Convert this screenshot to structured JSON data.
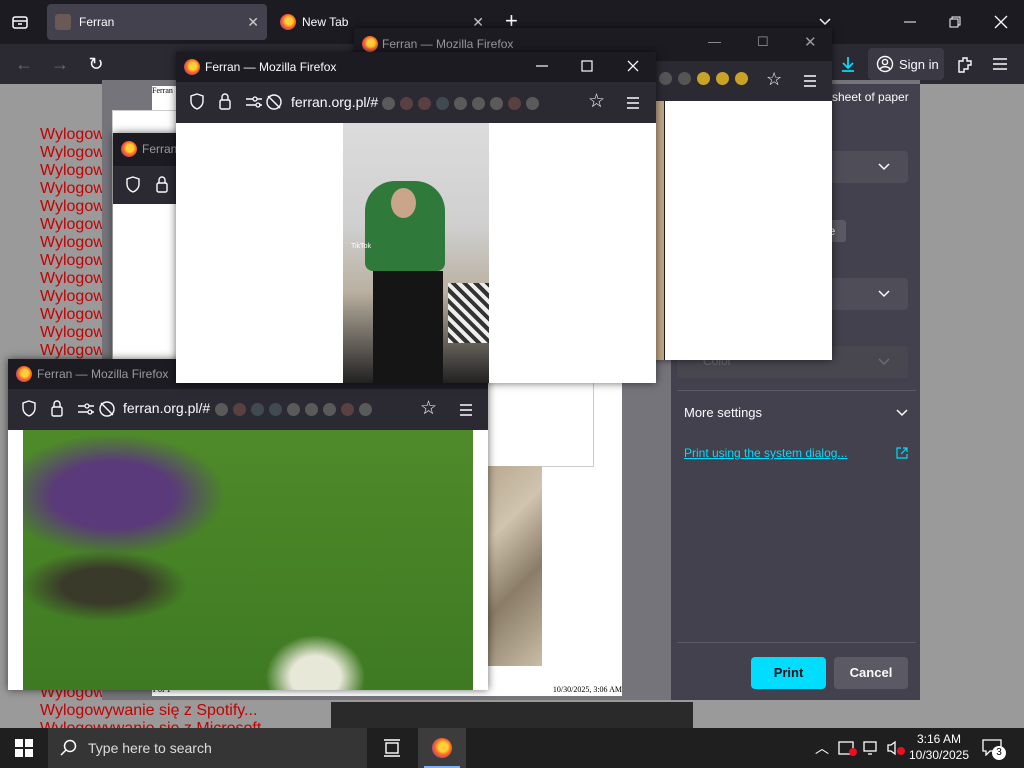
{
  "browser": {
    "tabs": [
      {
        "label": "Ferran",
        "close": "✕"
      },
      {
        "label": "New Tab",
        "close": "✕"
      }
    ],
    "new_tab": "+",
    "sign_in": "Sign in"
  },
  "page": {
    "lines": [
      "Wylogow",
      "Wylogow",
      "Wylogow",
      "Wylogow",
      "Wylogow",
      "Wylogow",
      "Wylogow",
      "Wylogow",
      "Wylogow",
      "Wylogow",
      "Wylogow",
      "Wylogow",
      "Wylogow"
    ],
    "bottom_lines": [
      "Wylogow",
      "Wylogowywanie się z Spotify...",
      "Wylogowywanie się z Microsoft..."
    ]
  },
  "print": {
    "sheet_label": "sheet of paper",
    "color_label": "Color",
    "more_settings": "More settings",
    "system_dialog": "Print using the system dialog...",
    "print_btn": "Print",
    "cancel_btn": "Cancel",
    "preview_header": "Ferran",
    "preview_footer_left": "1 of 1",
    "preview_footer_right": "10/30/2025, 3:06 AM",
    "badge": "e"
  },
  "windows": {
    "back": {
      "title": "Ferran — Mozilla Firefox"
    },
    "front": {
      "title": "Ferran — Mozilla Firefox",
      "url": "ferran.org.pl/#"
    },
    "lower": {
      "title": "Ferran — Mozilla Firefox",
      "url": "ferran.org.pl/#"
    },
    "small": {
      "title": "Ferran"
    },
    "tiktok": "TikTok"
  },
  "taskbar": {
    "search_placeholder": "Type here to search",
    "time": "3:16 AM",
    "date": "10/30/2025",
    "notif_count": "3"
  },
  "colors": {
    "accent": "#00ddff",
    "link": "#00ddff",
    "red_text": "#c40000"
  }
}
